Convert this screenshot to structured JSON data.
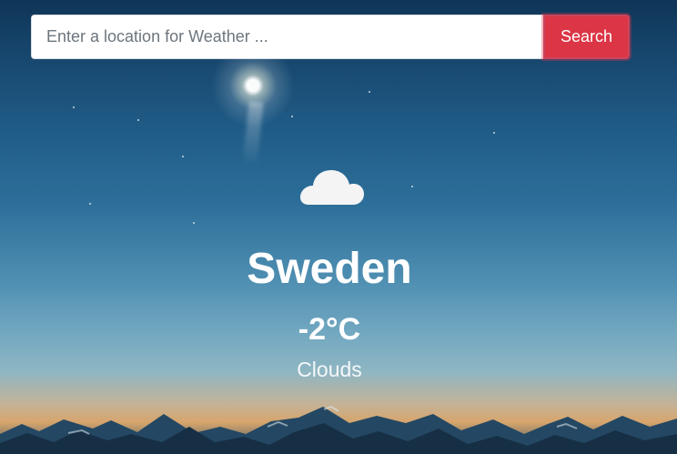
{
  "search": {
    "placeholder": "Enter a location for Weather ...",
    "button_label": "Search"
  },
  "weather": {
    "icon": "cloud-icon",
    "location": "Sweden",
    "temperature": "-2°C",
    "condition": "Clouds"
  },
  "colors": {
    "search_button": "#dc3545",
    "text": "#ffffff"
  }
}
